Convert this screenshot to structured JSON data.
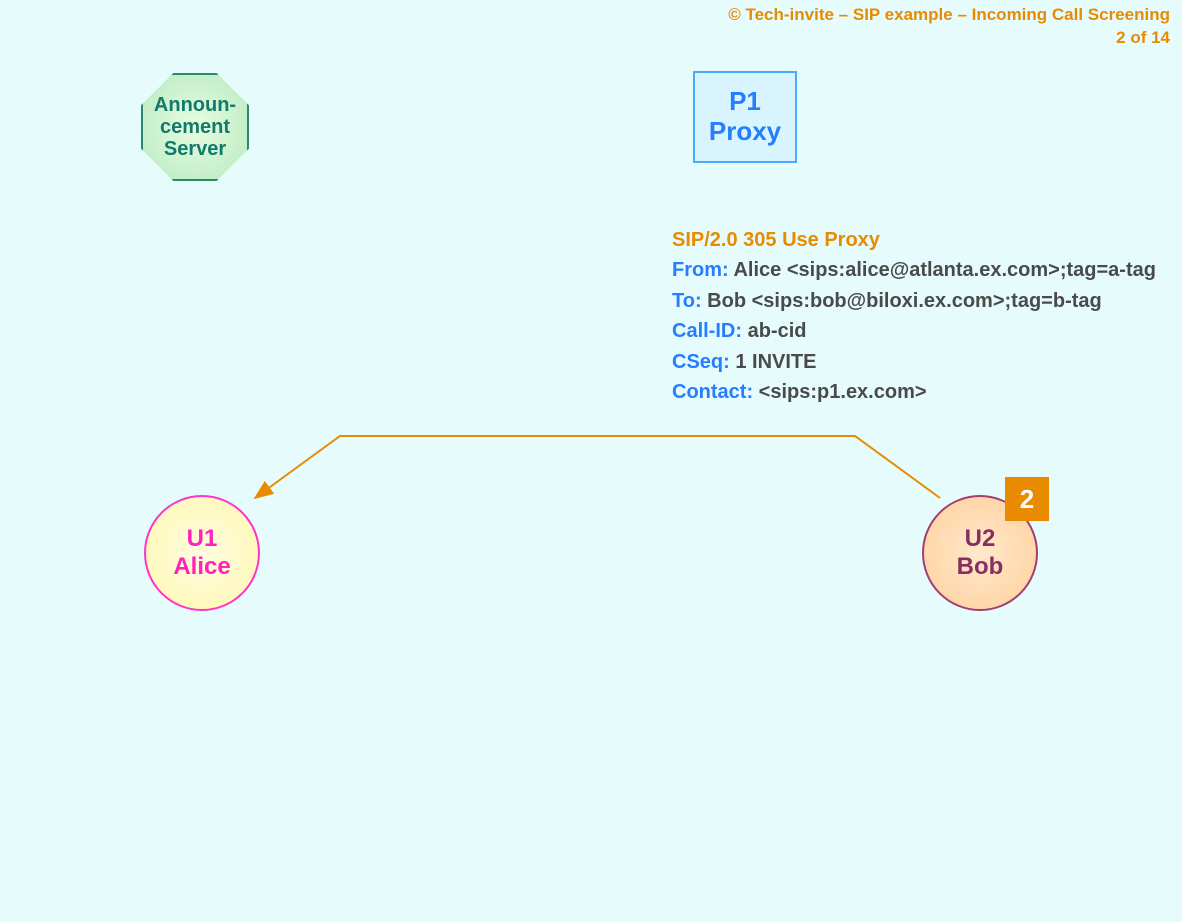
{
  "header": {
    "line1": "© Tech-invite – SIP example – Incoming Call Screening",
    "line2": "2 of 14"
  },
  "nodes": {
    "announcement_server": {
      "line1": "Announ-",
      "line2": "cement",
      "line3": "Server"
    },
    "p1_proxy": {
      "line1": "P1",
      "line2": "Proxy"
    },
    "u1": {
      "line1": "U1",
      "line2": "Alice"
    },
    "u2": {
      "line1": "U2",
      "line2": "Bob"
    }
  },
  "step_badge": "2",
  "sip_message": {
    "status_line": "SIP/2.0 305 Use Proxy",
    "headers": [
      {
        "name": "From",
        "value": " Alice <sips:alice@atlanta.ex.com>;tag=a-tag"
      },
      {
        "name": "To",
        "value": " Bob <sips:bob@biloxi.ex.com>;tag=b-tag"
      },
      {
        "name": "Call-ID",
        "value": " ab-cid"
      },
      {
        "name": "CSeq",
        "value": " 1 INVITE"
      },
      {
        "name": "Contact",
        "value": " <sips:p1.ex.com>"
      }
    ]
  },
  "arrow": {
    "from": "U2 Bob",
    "to": "U1 Alice",
    "direction": "response"
  }
}
